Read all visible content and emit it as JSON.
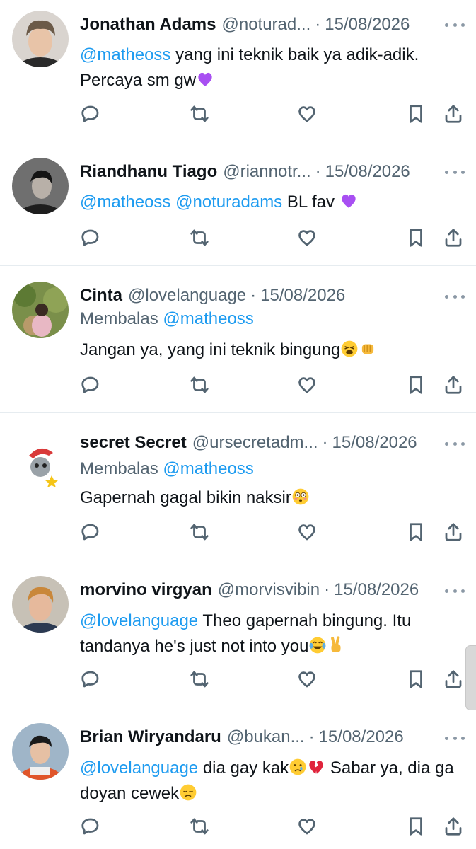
{
  "tweets": [
    {
      "name": "Jonathan Adams",
      "handle": "@noturad...",
      "separator": "·",
      "date": "15/08/2026",
      "replying_label": "",
      "replying_to": "",
      "segments": [
        {
          "t": "@matheoss",
          "m": true
        },
        {
          "t": " yang ini teknik baik ya adik-adik. Percaya sm gw",
          "m": false
        },
        {
          "e": "purple-heart-emoji"
        }
      ]
    },
    {
      "name": "Riandhanu Tiago",
      "handle": "@riannotr...",
      "separator": "·",
      "date": "15/08/2026",
      "replying_label": "",
      "replying_to": "",
      "segments": [
        {
          "t": "@matheoss @noturadams",
          "m": true
        },
        {
          "t": " BL fav ",
          "m": false
        },
        {
          "e": "purple-heart-emoji"
        }
      ]
    },
    {
      "name": "Cinta",
      "handle": "@lovelanguage",
      "separator": "·",
      "date": "15/08/2026",
      "replying_label": "Membalas",
      "replying_to": "@matheoss",
      "segments": [
        {
          "t": "Jangan ya, yang ini teknik bingung",
          "m": false
        },
        {
          "e": "tired-face-emoji"
        },
        {
          "e": "fist-bump-emoji"
        }
      ]
    },
    {
      "name": "secret Secret",
      "handle": "@ursecretadm...",
      "separator": "·",
      "date": "15/08/2026",
      "replying_label": "Membalas",
      "replying_to": "@matheoss",
      "segments": [
        {
          "t": "Gapernah gagal bikin naksir",
          "m": false
        },
        {
          "e": "flushed-face-emoji"
        }
      ]
    },
    {
      "name": "morvino virgyan",
      "handle": "@morvisvibin",
      "separator": "·",
      "date": "15/08/2026",
      "replying_label": "",
      "replying_to": "",
      "segments": [
        {
          "t": "@lovelanguage",
          "m": true
        },
        {
          "t": " Theo gapernah bingung. Itu tandanya he's just not into you",
          "m": false
        },
        {
          "e": "laughing-tears-emoji"
        },
        {
          "e": "victory-hand-emoji"
        }
      ]
    },
    {
      "name": "Brian Wiryandaru",
      "handle": "@bukan...",
      "separator": "·",
      "date": "15/08/2026",
      "replying_label": "",
      "replying_to": "",
      "segments": [
        {
          "t": "@lovelanguage",
          "m": true
        },
        {
          "t": " dia gay kak",
          "m": false
        },
        {
          "e": "crying-face-emoji"
        },
        {
          "e": "broken-heart-emoji"
        },
        {
          "t": " Sabar ya, dia ga doyan cewek",
          "m": false
        },
        {
          "e": "disappointed-face-emoji"
        }
      ]
    }
  ],
  "icons": [
    "reply-icon",
    "retweet-icon",
    "like-icon",
    "bookmark-icon",
    "share-icon",
    "more-icon"
  ],
  "colors": {
    "accent": "#1d9bf0",
    "muted": "#536471",
    "text": "#0f1419",
    "divider": "#e6ecf0"
  }
}
